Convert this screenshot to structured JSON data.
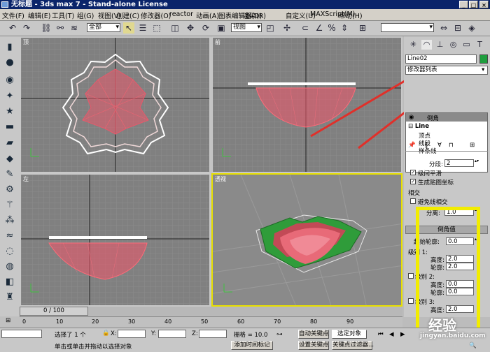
{
  "window": {
    "title": "无标题 - 3ds max 7 - Stand-alone License",
    "min": "_",
    "max": "□",
    "close": "×"
  },
  "menu": [
    "文件(F)",
    "编辑(E)",
    "工具(T)",
    "组(G)",
    "视图(V)",
    "创建(C)",
    "修改器(O)",
    "reactor",
    "动画(A)",
    "图表编辑器(D)",
    "渲染(R)",
    "自定义(U)",
    "MAXScript(M)",
    "帮助(H)"
  ],
  "toolbar": {
    "selection_filter": "全部",
    "reference_coord": "视图",
    "named_selection": ""
  },
  "viewports": {
    "top": "顶",
    "front": "前",
    "left": "左",
    "perspective": "透视"
  },
  "command_panel": {
    "object_name": "Line02",
    "color": "#1e9e3e",
    "modifier_list": "修改器列表",
    "stack": {
      "modifier": "倒角",
      "base": "Line",
      "sub": [
        "顶点",
        "线段",
        "样条线"
      ]
    },
    "params": {
      "segments_label": "分段:",
      "segments": "2",
      "smooth": "级间平滑",
      "gen_map": "生成贴图坐标",
      "intersect_group": "相交",
      "avoid": "避免线相交",
      "separation_label": "分离:",
      "separation": "1.0",
      "bevel_rollout": "倒角值",
      "start_outline_label": "起始轮廓:",
      "start_outline": "0.0",
      "level1": "级别 1:",
      "level2": "级别 2:",
      "level3": "级别 3:",
      "height_label": "高度:",
      "outline_label": "轮廓:",
      "l1_height": "2.0",
      "l1_outline": "2.0",
      "l2_height": "0.0",
      "l2_outline": "0.0",
      "l3_height": "2.0",
      "l3_outline": "0.0"
    }
  },
  "timeline": {
    "frame": "0 / 100",
    "ticks": [
      "0",
      "10",
      "20",
      "30",
      "40",
      "50",
      "60",
      "70",
      "80",
      "90"
    ]
  },
  "status": {
    "selected": "选择了 1 个",
    "x_label": "X:",
    "y_label": "Y:",
    "z_label": "Z:",
    "grid": "栅格 = 10.0",
    "autokey": "自动关键点",
    "setkey": "设置关键点",
    "selected_object": "选定对象",
    "key_filter": "关键点过滤器...",
    "prompt": "单击或单击并拖动以选择对象",
    "add_time_tag": "添加时间标记"
  },
  "watermark": "经验",
  "watermark_url": "jingyan.baidu.com",
  "colors": {
    "shape_white": "#ffffff",
    "mesh_red": "#e85a6a",
    "solid_green": "#2f9c3a",
    "highlight": "#f2ec00",
    "arrow_red": "#e0302a"
  }
}
